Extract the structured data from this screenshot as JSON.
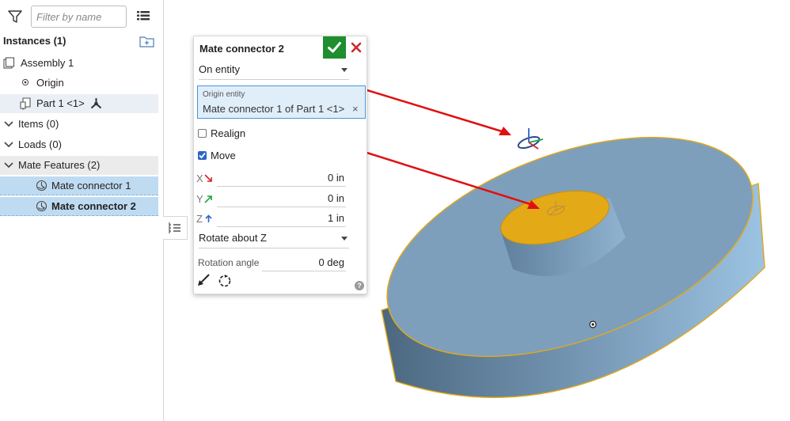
{
  "filter": {
    "placeholder": "Filter by name"
  },
  "instances": {
    "header": "Instances (1)"
  },
  "tree": {
    "assembly": "Assembly 1",
    "origin": "Origin",
    "part": "Part 1 <1>",
    "items": "Items (0)",
    "loads": "Loads (0)",
    "mate_features": "Mate Features (2)",
    "mate_connector_1": "Mate connector 1",
    "mate_connector_2": "Mate connector 2"
  },
  "dialog": {
    "title": "Mate connector 2",
    "mode_select": "On entity",
    "origin_entity_label": "Origin entity",
    "origin_entity_value": "Mate connector 1 of Part 1 <1>",
    "origin_clear": "×",
    "realign_label": "Realign",
    "realign_checked": false,
    "move_label": "Move",
    "move_checked": true,
    "x_label": "X",
    "x_value": "0 in",
    "y_label": "Y",
    "y_value": "0 in",
    "z_label": "Z",
    "z_value": "1 in",
    "rotate_select": "Rotate about Z",
    "rotation_angle_label": "Rotation angle",
    "rotation_angle_value": "0 deg",
    "help": "?"
  },
  "icons": {
    "filter": "filter-icon",
    "list_view": "list-view-icon",
    "add_folder": "add-folder-icon",
    "assembly": "assembly-icon",
    "origin": "origin-icon",
    "part": "part-icon",
    "mate_connector": "mate-connector-icon",
    "ok": "check-icon",
    "cancel": "close-icon"
  },
  "colors": {
    "accept_green": "#1e8e2e",
    "cancel_red": "#d0262e",
    "selection_blue": "#bfdbf2",
    "part_face": "#7e9fbc",
    "highlight_yellow": "#e3a916",
    "annotation_red": "#e01010"
  }
}
